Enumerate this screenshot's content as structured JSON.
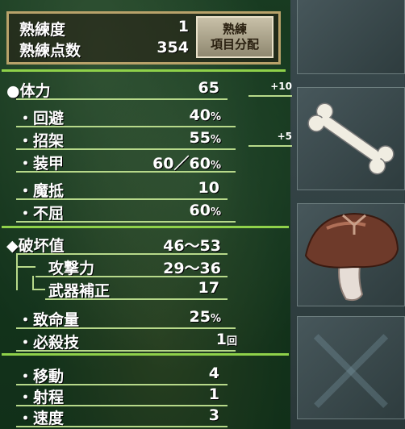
{
  "proficiency": {
    "level_label": "熟練度",
    "level_value": "1",
    "points_label": "熟練点数",
    "points_value": "354",
    "allocate_button": "熟練\n項目分配"
  },
  "stats": {
    "hp": {
      "label": "●体力",
      "value": "65",
      "bonus": "+10"
    },
    "evasion": {
      "label": "回避",
      "value": "40",
      "unit": "%"
    },
    "parry": {
      "label": "招架",
      "value": "55",
      "unit": "%",
      "bonus": "+5"
    },
    "armor": {
      "label": "装甲",
      "value": "60／60",
      "unit": "%"
    },
    "magic_resist": {
      "label": "魔抵",
      "value": "10"
    },
    "tenacity": {
      "label": "不屈",
      "value": "60",
      "unit": "%"
    },
    "destruction": {
      "label": "◆破坏值",
      "value": "46〜53"
    },
    "attack": {
      "label": "攻撃力",
      "value": "29〜36"
    },
    "weapon_bonus": {
      "label": "武器補正",
      "value": "17"
    },
    "crit": {
      "label": "致命量",
      "value": "25",
      "unit": "%"
    },
    "special": {
      "label": "必殺技",
      "value": "1",
      "unit": "回"
    },
    "move": {
      "label": "移動",
      "value": "4"
    },
    "range": {
      "label": "射程",
      "value": "1"
    },
    "speed": {
      "label": "速度",
      "value": "3"
    }
  },
  "bullet": "・",
  "equipment": {
    "slot1": "empty",
    "slot2": "bone-icon",
    "slot3": "mushroom-icon",
    "slot4": "empty-x-icon"
  },
  "colors": {
    "accent": "#8fd14a",
    "frame": "#b8a26a"
  }
}
